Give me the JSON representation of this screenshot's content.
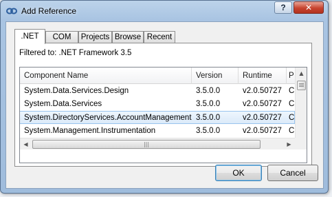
{
  "window": {
    "title": "Add Reference",
    "help_label": "?",
    "close_label": "✕"
  },
  "tabs": [
    {
      "label": ".NET",
      "active": true
    },
    {
      "label": "COM",
      "active": false
    },
    {
      "label": "Projects",
      "active": false
    },
    {
      "label": "Browse",
      "active": false
    },
    {
      "label": "Recent",
      "active": false
    }
  ],
  "filter_text": "Filtered to: .NET Framework 3.5",
  "list": {
    "columns": [
      "Component Name",
      "Version",
      "Runtime",
      "P"
    ],
    "rows": [
      {
        "name": "System.Data.Services.Design",
        "version": "3.5.0.0",
        "runtime": "v2.0.50727",
        "path": "C"
      },
      {
        "name": "System.Data.Services",
        "version": "3.5.0.0",
        "runtime": "v2.0.50727",
        "path": "C"
      },
      {
        "name": "System.DirectoryServices.AccountManagement",
        "version": "3.5.0.0",
        "runtime": "v2.0.50727",
        "path": "C"
      },
      {
        "name": "System.Management.Instrumentation",
        "version": "3.5.0.0",
        "runtime": "v2.0.50727",
        "path": "C"
      }
    ],
    "selected_row": 2
  },
  "scrollbars": {
    "up_glyph": "▲",
    "left_glyph": "◀",
    "right_glyph": "▶",
    "hthumb_grip": "|||"
  },
  "buttons": {
    "ok": "OK",
    "cancel": "Cancel"
  },
  "colors": {
    "title_gradient": "#a9c4e2",
    "selection": "#dbeaf9",
    "close": "#c7432f"
  }
}
